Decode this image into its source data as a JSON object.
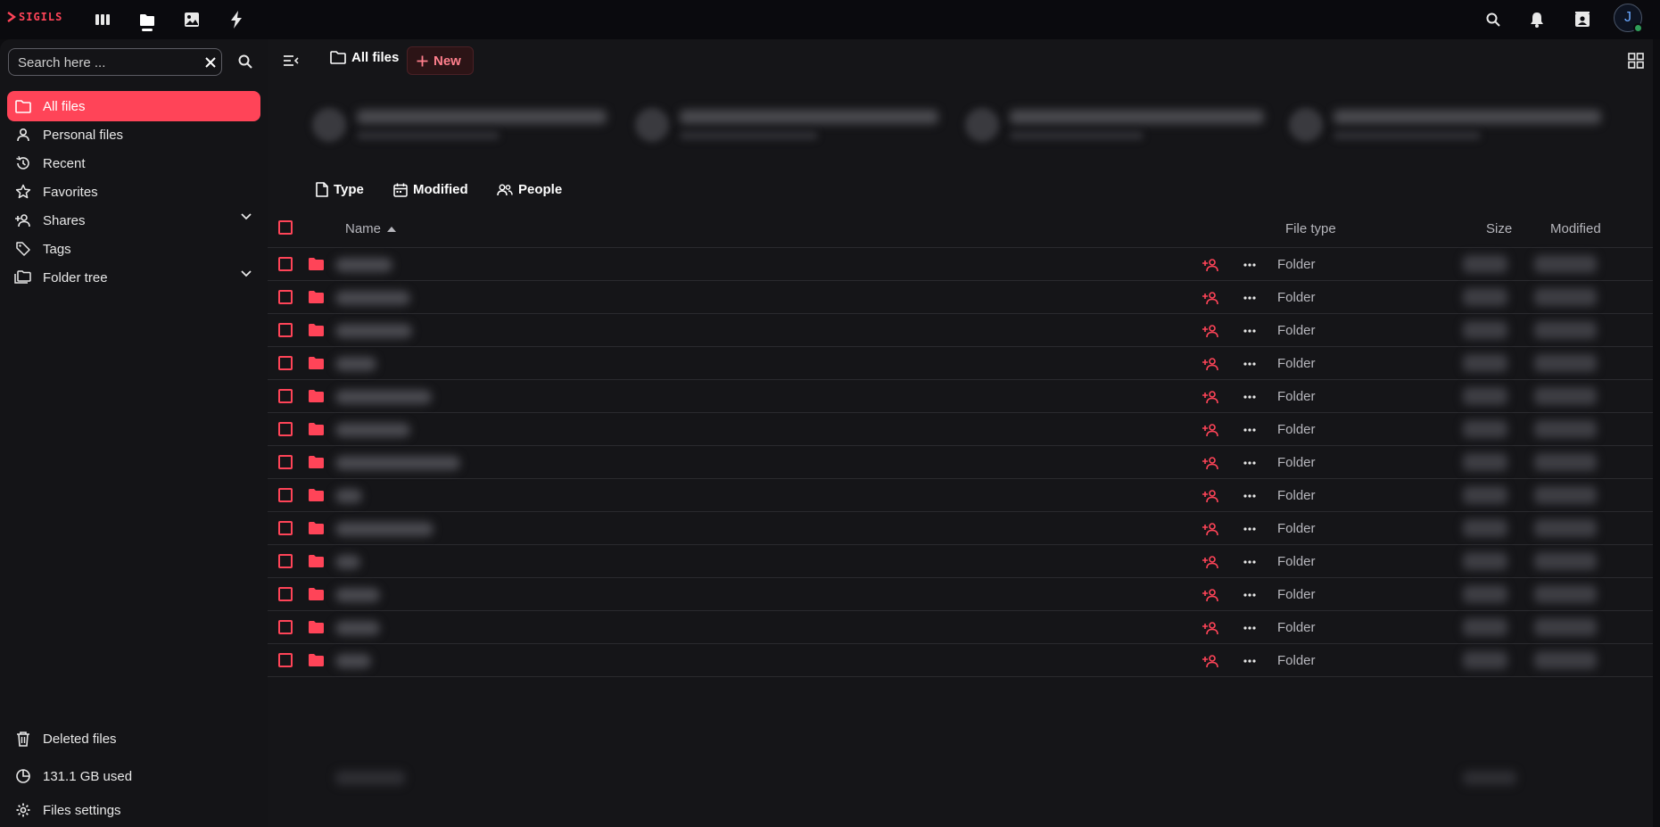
{
  "topbar": {
    "logo_text": "SIGILS",
    "apps": [
      "dashboard-icon",
      "files-icon",
      "photos-icon",
      "activity-icon"
    ],
    "active_app": "files"
  },
  "user": {
    "avatar_initial": "J",
    "status": "online"
  },
  "sidebar": {
    "search_placeholder": "Search here ...",
    "items": [
      {
        "label": "All files",
        "icon": "folder-icon",
        "active": true
      },
      {
        "label": "Personal files",
        "icon": "person-icon"
      },
      {
        "label": "Recent",
        "icon": "history-icon"
      },
      {
        "label": "Favorites",
        "icon": "star-icon"
      },
      {
        "label": "Shares",
        "icon": "share-icon",
        "expandable": true
      },
      {
        "label": "Tags",
        "icon": "tag-icon"
      },
      {
        "label": "Folder tree",
        "icon": "folder-tree-icon",
        "expandable": true
      }
    ],
    "bottom": {
      "deleted": "Deleted files",
      "quota": "131.1 GB used",
      "settings": "Files settings"
    }
  },
  "header": {
    "breadcrumb": "All files",
    "new_button": "New"
  },
  "filters": [
    "Type",
    "Modified",
    "People"
  ],
  "table": {
    "columns": {
      "name": "Name",
      "type": "File type",
      "size": "Size",
      "modified": "Modified"
    },
    "sort": {
      "column": "name",
      "direction": "ascending"
    },
    "rows": [
      {
        "type": "Folder"
      },
      {
        "type": "Folder"
      },
      {
        "type": "Folder"
      },
      {
        "type": "Folder"
      },
      {
        "type": "Folder"
      },
      {
        "type": "Folder"
      },
      {
        "type": "Folder"
      },
      {
        "type": "Folder"
      },
      {
        "type": "Folder"
      },
      {
        "type": "Folder"
      },
      {
        "type": "Folder"
      },
      {
        "type": "Folder"
      },
      {
        "type": "Folder"
      }
    ]
  },
  "colors": {
    "accent": "#ff4458",
    "background": "#151518",
    "sidebar": "#141417",
    "topbar": "#0a0a0e"
  }
}
